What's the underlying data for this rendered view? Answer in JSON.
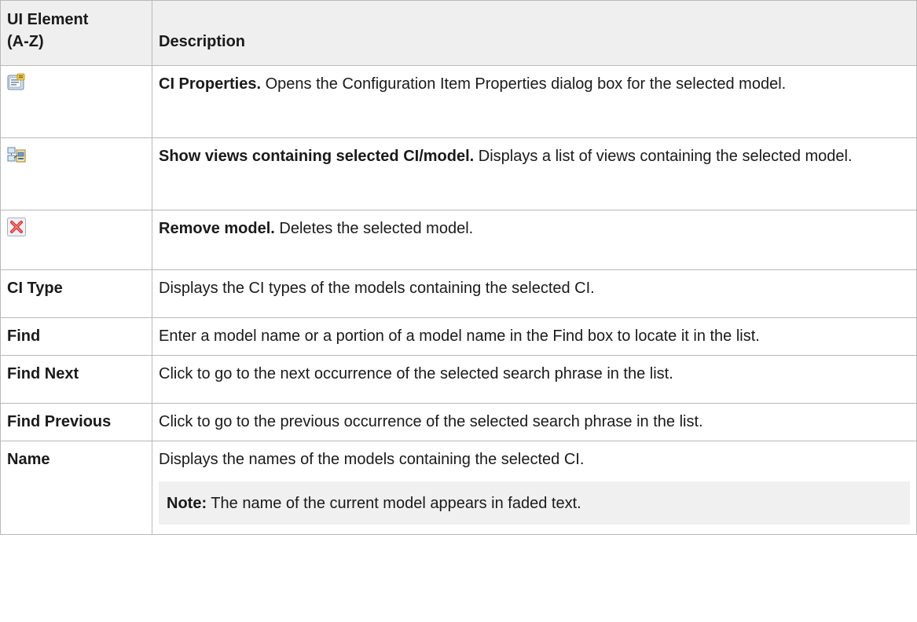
{
  "table": {
    "headers": [
      "UI Element\n(A-Z)",
      "Description"
    ],
    "header_col1_line1": "UI Element",
    "header_col1_line2": "(A-Z)",
    "header_col2": "Description",
    "rows": [
      {
        "icon": "ci-properties-icon",
        "bold": "CI Properties.",
        "text": " Opens the Configuration Item Properties dialog box for the selected model."
      },
      {
        "icon": "show-views-icon",
        "bold": "Show views containing selected CI/model.",
        "text": " Displays a list of views containing the selected model."
      },
      {
        "icon": "remove-model-icon",
        "bold": "Remove model.",
        "text": " Deletes the selected model."
      },
      {
        "element": "CI Type",
        "text": "Displays the CI types of the models containing the selected CI."
      },
      {
        "element": "Find",
        "text": "Enter a model name or a portion of a model name in the Find box to locate it in the list."
      },
      {
        "element": "Find Next",
        "text": "Click to go to the next occurrence of the selected search phrase in the list."
      },
      {
        "element": "Find Previous",
        "text": "Click to go to the previous occurrence of the selected search phrase in the list."
      },
      {
        "element": "Name",
        "text": "Displays the names of the models containing the selected CI.",
        "note_bold": "Note:",
        "note_text": " The name of the current model appears in faded text."
      }
    ]
  },
  "colors": {
    "border": "#b9b9b9",
    "header_bg": "#efefef",
    "note_bg": "#f0f0f0",
    "remove_icon_red": "#d9322f"
  }
}
